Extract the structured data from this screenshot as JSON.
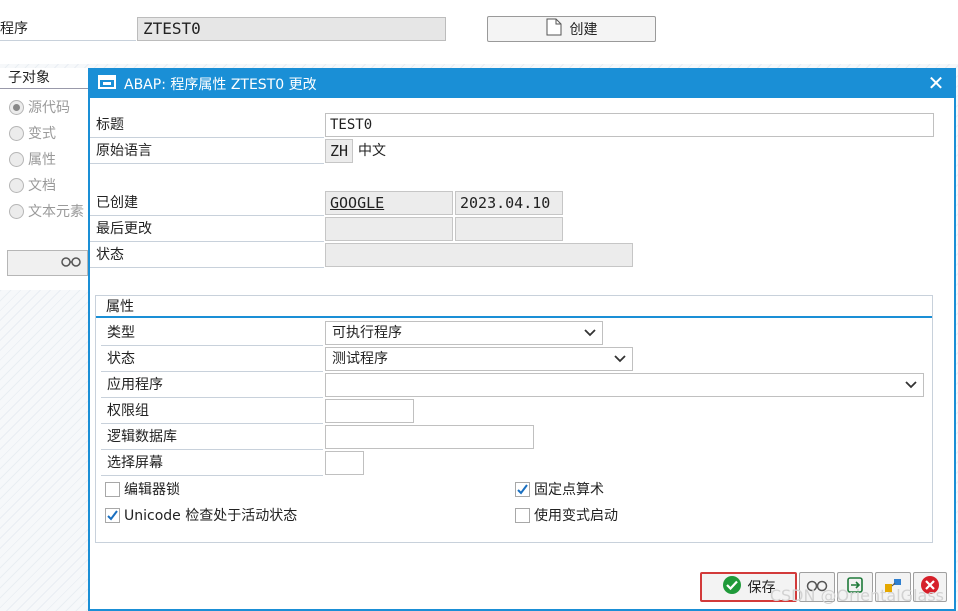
{
  "background": {
    "program_label": "程序",
    "program_value": "ZTEST0",
    "create_button": "创建",
    "subobjects_title": "子对象",
    "radios": [
      "源代码",
      "变式",
      "属性",
      "文档",
      "文本元素"
    ]
  },
  "dialog": {
    "title": "ABAP: 程序属性 ZTEST0 更改",
    "fields": {
      "title_label": "标题",
      "title_value": "TEST0",
      "orig_lang_label": "原始语言",
      "orig_lang_code": "ZH",
      "orig_lang_name": "中文",
      "created_label": "已创建",
      "created_by": "GOOGLE",
      "created_on": "2023.04.10",
      "last_changed_label": "最后更改",
      "status_label": "状态"
    },
    "attributes": {
      "group_title": "属性",
      "type_label": "类型",
      "type_value": "可执行程序",
      "status_label": "状态",
      "status_value": "测试程序",
      "app_label": "应用程序",
      "app_value": "",
      "auth_group_label": "权限组",
      "logical_db_label": "逻辑数据库",
      "selection_screen_label": "选择屏幕",
      "editor_lock_label": "编辑器锁",
      "fixed_point_label": "固定点算术",
      "unicode_check_label": "Unicode 检查处于活动状态",
      "start_variant_label": "使用变式启动",
      "editor_lock_checked": false,
      "fixed_point_checked": true,
      "unicode_checked": true,
      "start_variant_checked": false
    },
    "buttons": {
      "save": "保存"
    }
  },
  "watermark": "CSDN @OrientalGlass",
  "colors": {
    "accent": "#1a8fd6",
    "check": "#1a6fc0",
    "save_icon": "#1f9a3a",
    "cancel_icon": "#d6202a"
  }
}
